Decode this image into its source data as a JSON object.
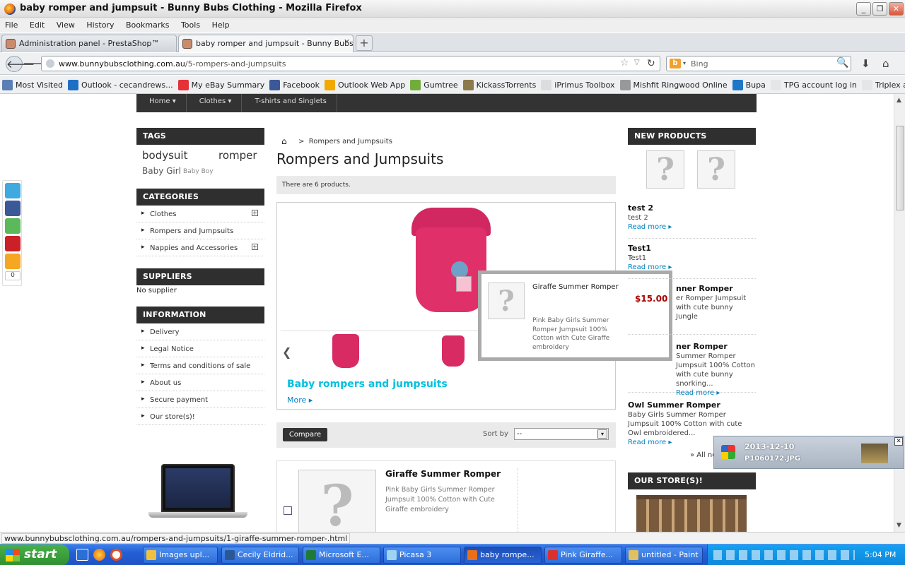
{
  "window": {
    "title": "baby romper and jumpsuit - Bunny Bubs Clothing - Mozilla Firefox"
  },
  "menu": [
    "File",
    "Edit",
    "View",
    "History",
    "Bookmarks",
    "Tools",
    "Help"
  ],
  "tabs": [
    {
      "label": "Administration panel - PrestaShop™"
    },
    {
      "label": "baby romper and jumpsuit - Bunny Bubs ..."
    }
  ],
  "url": {
    "domain": "www.bunnybubsclothing.com.au",
    "path": "/5-rompers-and-jumpsuits"
  },
  "search": {
    "engine": "Bing",
    "placeholder": "Bing"
  },
  "bookmarks": [
    {
      "label": "Most Visited",
      "color": "#5b7fb5"
    },
    {
      "label": "Outlook - cecandrews...",
      "color": "#1e6fc4"
    },
    {
      "label": "My eBay Summary",
      "color": "#e53238"
    },
    {
      "label": "Facebook",
      "color": "#3b5998"
    },
    {
      "label": "Outlook Web App",
      "color": "#f2a900"
    },
    {
      "label": "Gumtree",
      "color": "#72ad3c"
    },
    {
      "label": "KickassTorrents",
      "color": "#8c7a4a"
    },
    {
      "label": "iPrimus Toolbox",
      "color": "#dddddd"
    },
    {
      "label": "Mishfit Ringwood Online",
      "color": "#999999"
    },
    {
      "label": "Bupa",
      "color": "#1f77c8"
    },
    {
      "label": "TPG account log in",
      "color": "#e6e6e6"
    },
    {
      "label": "Triplex anti-parasite ti...",
      "color": "#e6e6e6"
    }
  ],
  "site": {
    "topnav": [
      "Home",
      "Clothes",
      "T-shirts and Singlets"
    ],
    "tags": {
      "title": "TAGS",
      "items": [
        "bodysuit",
        "romper",
        "Baby Girl",
        "Baby Boy"
      ]
    },
    "categories": {
      "title": "CATEGORIES",
      "items": [
        "Clothes",
        "Rompers and Jumpsuits",
        "Nappies and Accessories"
      ]
    },
    "suppliers": {
      "title": "SUPPLIERS",
      "text": "No supplier"
    },
    "information": {
      "title": "INFORMATION",
      "items": [
        "Delivery",
        "Legal Notice",
        "Terms and conditions of sale",
        "About us",
        "Secure payment",
        "Our store(s)!"
      ]
    },
    "breadcrumb": "Rompers and Jumpsuits",
    "page_title": "Rompers and Jumpsuits",
    "product_count": "There are 6 products.",
    "slider": {
      "caption": "Baby rompers and jumpsuits",
      "more": "More"
    },
    "popup": {
      "name": "Giraffe Summer Romper",
      "price": "$15.00",
      "desc": "Pink Baby Girls Summer Romper Jumpsuit 100% Cotton with Cute Giraffe embroidery"
    },
    "compare": "Compare",
    "sort_label": "Sort by",
    "sort_value": "--",
    "product": {
      "name": "Giraffe Summer Romper",
      "desc": "Pink Baby Girls Summer Romper Jumpsuit 100% Cotton with Cute Giraffe embroidery"
    },
    "new_products": {
      "title": "NEW PRODUCTS",
      "items": [
        {
          "name": "test 2",
          "desc": "test 2",
          "more": "Read more"
        },
        {
          "name": "Test1",
          "desc": "Test1",
          "more": "Read more"
        },
        {
          "name": "nner Romper",
          "desc": "er Romper Jumpsuit with cute bunny Jungle",
          "more": ""
        },
        {
          "name": "ner Romper",
          "desc": "Summer Romper Jumpsuit 100% Cotton with cute bunny snorking...",
          "more": "Read more"
        },
        {
          "name": "Owl Summer Romper",
          "desc": "Baby Girls Summer Romper Jumpsuit 100% Cotton with cute Owl embroidered...",
          "more": "Read more"
        }
      ],
      "all": "» All ne"
    },
    "stores": {
      "title": "OUR STORE(S)!"
    },
    "share_count": "0"
  },
  "status": "www.bunnybubsclothing.com.au/rompers-and-jumpsuits/1-giraffe-summer-romper-.html",
  "notification": {
    "title": "2013-12-10",
    "file": "P1060172.JPG"
  },
  "taskbar": {
    "start": "start",
    "tasks": [
      {
        "label": "Images upl...",
        "color": "#f0c040"
      },
      {
        "label": "Cecily Eldrid...",
        "color": "#2b5797"
      },
      {
        "label": "Microsoft E...",
        "color": "#1f7a3a"
      },
      {
        "label": "Picasa 3",
        "color": "#9fd3f0"
      },
      {
        "label": "baby rompe...",
        "color": "#e8701a"
      },
      {
        "label": "Pink Giraffe...",
        "color": "#d93030"
      },
      {
        "label": "untitled - Paint",
        "color": "#e0c060"
      }
    ],
    "clock": "5:04 PM"
  }
}
